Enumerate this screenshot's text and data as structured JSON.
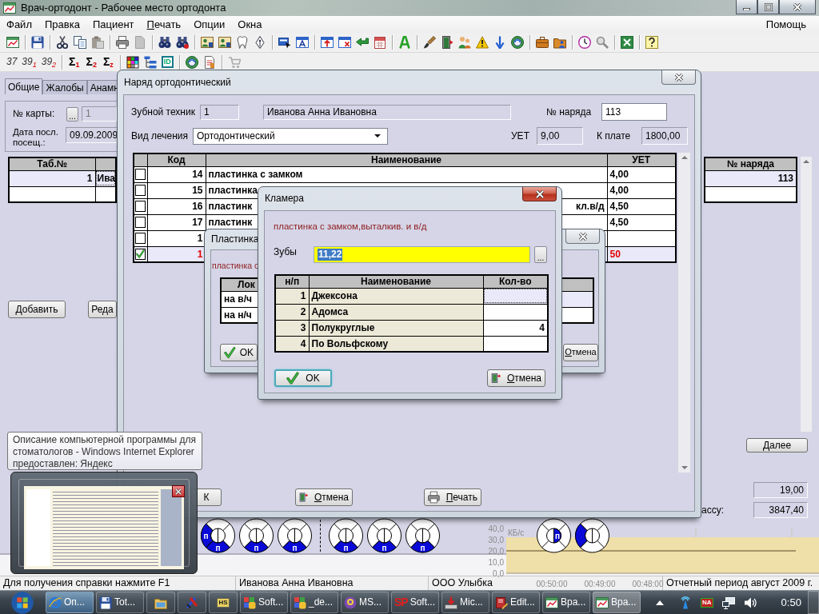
{
  "window": {
    "title": "Врач-ортодонт - Рабочее место ортодонта"
  },
  "menu": [
    {
      "label": "Файл",
      "mnemonic": false
    },
    {
      "label": "Правка",
      "mnemonic": false
    },
    {
      "label": "Пациент",
      "mnemonic": false
    },
    {
      "label": "Печать",
      "mnemonic": true
    },
    {
      "label": "Опции",
      "mnemonic": false
    },
    {
      "label": "Окна",
      "mnemonic": false
    }
  ],
  "help_menu": {
    "label": "Помощь",
    "mnemonic": false
  },
  "toolbar_2": {
    "counts": [
      "37",
      "39$_{1}$",
      "39$_{2}$"
    ],
    "sums": [
      "Σ$_{1}$",
      "Σ$_{2}$",
      "Σ$_{z}$"
    ],
    "id_button": "ID"
  },
  "patient": {
    "tabs": [
      {
        "label": "Общие",
        "selected": true
      },
      {
        "label": "Жалобы",
        "selected": false
      },
      {
        "label": "Анамн",
        "selected": false
      }
    ],
    "card_label": "№ карты:",
    "card_browse": "...",
    "card_value": "1",
    "date_label": "Дата посл. посещ.:",
    "date_value": "09.09.2009",
    "table": {
      "columns": [
        "Таб.№"
      ],
      "rows": [
        {
          "tab_no": "1",
          "name": "Ива",
          "selected": true
        }
      ]
    },
    "buttons": [
      "Добавить",
      "Реда"
    ]
  },
  "orders": {
    "column": "№ наряда",
    "rows": [
      {
        "number": "113",
        "selected": true
      }
    ],
    "next_button": "Далее",
    "totals": [
      {
        "value": "19,00"
      },
      {
        "label": "ассу:",
        "value": "3847,40"
      }
    ]
  },
  "teeth_groups": [
    [
      {
        "surfaces": [
          {
            "kind": "ring-left",
            "mark": "п"
          },
          {
            "kind": "ring-bottom",
            "mark": "п"
          }
        ]
      },
      {
        "surfaces": [
          {
            "kind": "ring-bottom",
            "mark": "п"
          }
        ]
      },
      {
        "surfaces": [
          {
            "kind": "ring-bottom",
            "mark": "п"
          }
        ]
      }
    ],
    [
      {
        "surfaces": [
          {
            "kind": "ring-bottom",
            "mark": "п"
          }
        ]
      },
      {
        "surfaces": [
          {
            "kind": "ring-bottom",
            "mark": "п"
          }
        ]
      },
      {
        "surfaces": [
          {
            "kind": "ring-bottom",
            "mark": "п"
          }
        ]
      }
    ],
    [
      {
        "surfaces": [
          {
            "kind": "core-right",
            "mark": "п"
          }
        ]
      },
      {
        "surfaces": [
          {
            "kind": "ring-left"
          }
        ]
      }
    ]
  ],
  "network_monitor": {
    "unit": "КБ/с",
    "scale_labels": [
      "40,0",
      "30,0",
      "20,0",
      "10,0",
      "0,0"
    ],
    "time_labels": [
      "00:50:00",
      "00:49:00",
      "00:48:00"
    ]
  },
  "status_bar": [
    "Для получения справки нажмите F1",
    "Иванова Анна Ивановна",
    "ООО Улыбка",
    "Отчетный период август 2009 г."
  ],
  "order_dialog": {
    "title": "Наряд ортодонтический",
    "active": false,
    "technician_label": "Зубной техник",
    "technician_id": "1",
    "technician_name": "Иванова Анна Ивановна",
    "order_no_label": "№ наряда",
    "order_no": "113",
    "treatment_label": "Вид лечения",
    "treatment": "Ортодонтический",
    "uet_label": "УЕТ",
    "uet": "9,00",
    "pay_label": "К плате",
    "pay": "1800,00",
    "table": {
      "columns": [
        "Код",
        "Наименование",
        "УЕТ"
      ],
      "rows": [
        {
          "checked": false,
          "selected": false,
          "code": "14",
          "name": "пластинка с замком",
          "uet": "4,00"
        },
        {
          "checked": false,
          "selected": false,
          "code": "15",
          "name": "пластинка",
          "uet": "4,00"
        },
        {
          "checked": false,
          "selected": false,
          "code": "16",
          "name": "пластинк",
          "name_end": "кл.в/д",
          "uet": "4,50"
        },
        {
          "checked": false,
          "selected": false,
          "code": "17",
          "name": "пластинк",
          "uet": "4,50"
        },
        {
          "checked": false,
          "selected": false,
          "code": "1"
        },
        {
          "checked": true,
          "selected": true,
          "code": "1",
          "uet": "50"
        }
      ]
    },
    "buttons": [
      {
        "kind": "plain",
        "label": "К",
        "mnemonic": false
      },
      {
        "kind": "cancel",
        "label": "Отмена",
        "mnemonic": true
      },
      {
        "kind": "print",
        "label": "Печать",
        "mnemonic": true
      }
    ]
  },
  "plate_dialog": {
    "title": "Пластинка",
    "active": false,
    "description": "пластинка с",
    "table": {
      "columns": [
        "Лок"
      ],
      "rows": [
        {
          "label": "на в/ч",
          "selected": true
        },
        {
          "label": "на н/ч",
          "selected": false
        }
      ]
    },
    "buttons": [
      {
        "kind": "ok",
        "label": "OK",
        "mnemonic": false
      },
      {
        "kind": "plain",
        "label": "Отмена",
        "mnemonic": true
      }
    ]
  },
  "clasp_dialog": {
    "title": "Кламера",
    "active": true,
    "description": "пластинка с замком,выталкив. и в/д",
    "teeth_label": "Зубы",
    "teeth_value": "11,22",
    "teeth_value_selected": true,
    "browse_button": "...",
    "table": {
      "columns": [
        "н/п",
        "Наименование",
        "Кол-во"
      ],
      "rows": [
        {
          "no": "1",
          "name": "Джексона",
          "selected": true
        },
        {
          "no": "2",
          "name": "Адомса",
          "selected": false
        },
        {
          "no": "3",
          "name": "Полукруглые",
          "qty": "4",
          "selected": false
        },
        {
          "no": "4",
          "name": "По Вольфскому",
          "selected": false
        }
      ]
    },
    "buttons": [
      {
        "kind": "ok",
        "label": "OK",
        "mnemonic": false,
        "focused": true
      },
      {
        "kind": "cancel",
        "label": "Отмена",
        "mnemonic": true,
        "focused": false
      }
    ]
  },
  "preview": {
    "tooltip_lines": [
      "Описание компьютерной программы для",
      "стоматологов - Windows Internet Explorer",
      "предоставлен: Яндекс"
    ]
  },
  "taskbar": {
    "items": [
      {
        "label": "Оп...",
        "highlighted": true,
        "selected": false
      },
      {
        "label": "Tot...",
        "highlighted": false,
        "selected": false
      },
      {
        "highlighted": false,
        "selected": false
      },
      {
        "highlighted": false,
        "selected": false
      },
      {
        "badge": "HS",
        "highlighted": false,
        "selected": false
      },
      {
        "label": "Soft...",
        "highlighted": false,
        "selected": false
      },
      {
        "label": "_de...",
        "highlighted": false,
        "selected": false
      },
      {
        "label": "MS...",
        "highlighted": false,
        "selected": false
      },
      {
        "logo": "SP",
        "label": "Soft...",
        "highlighted": false,
        "selected": false
      },
      {
        "label": "Mic...",
        "highlighted": false,
        "selected": false
      },
      {
        "label": "Edit...",
        "highlighted": false,
        "selected": false
      },
      {
        "label": "Вра...",
        "highlighted": false,
        "selected": false
      },
      {
        "label": "Вра...",
        "highlighted": false,
        "selected": true
      }
    ],
    "tray_badge": "NA",
    "clock": "0:50"
  }
}
